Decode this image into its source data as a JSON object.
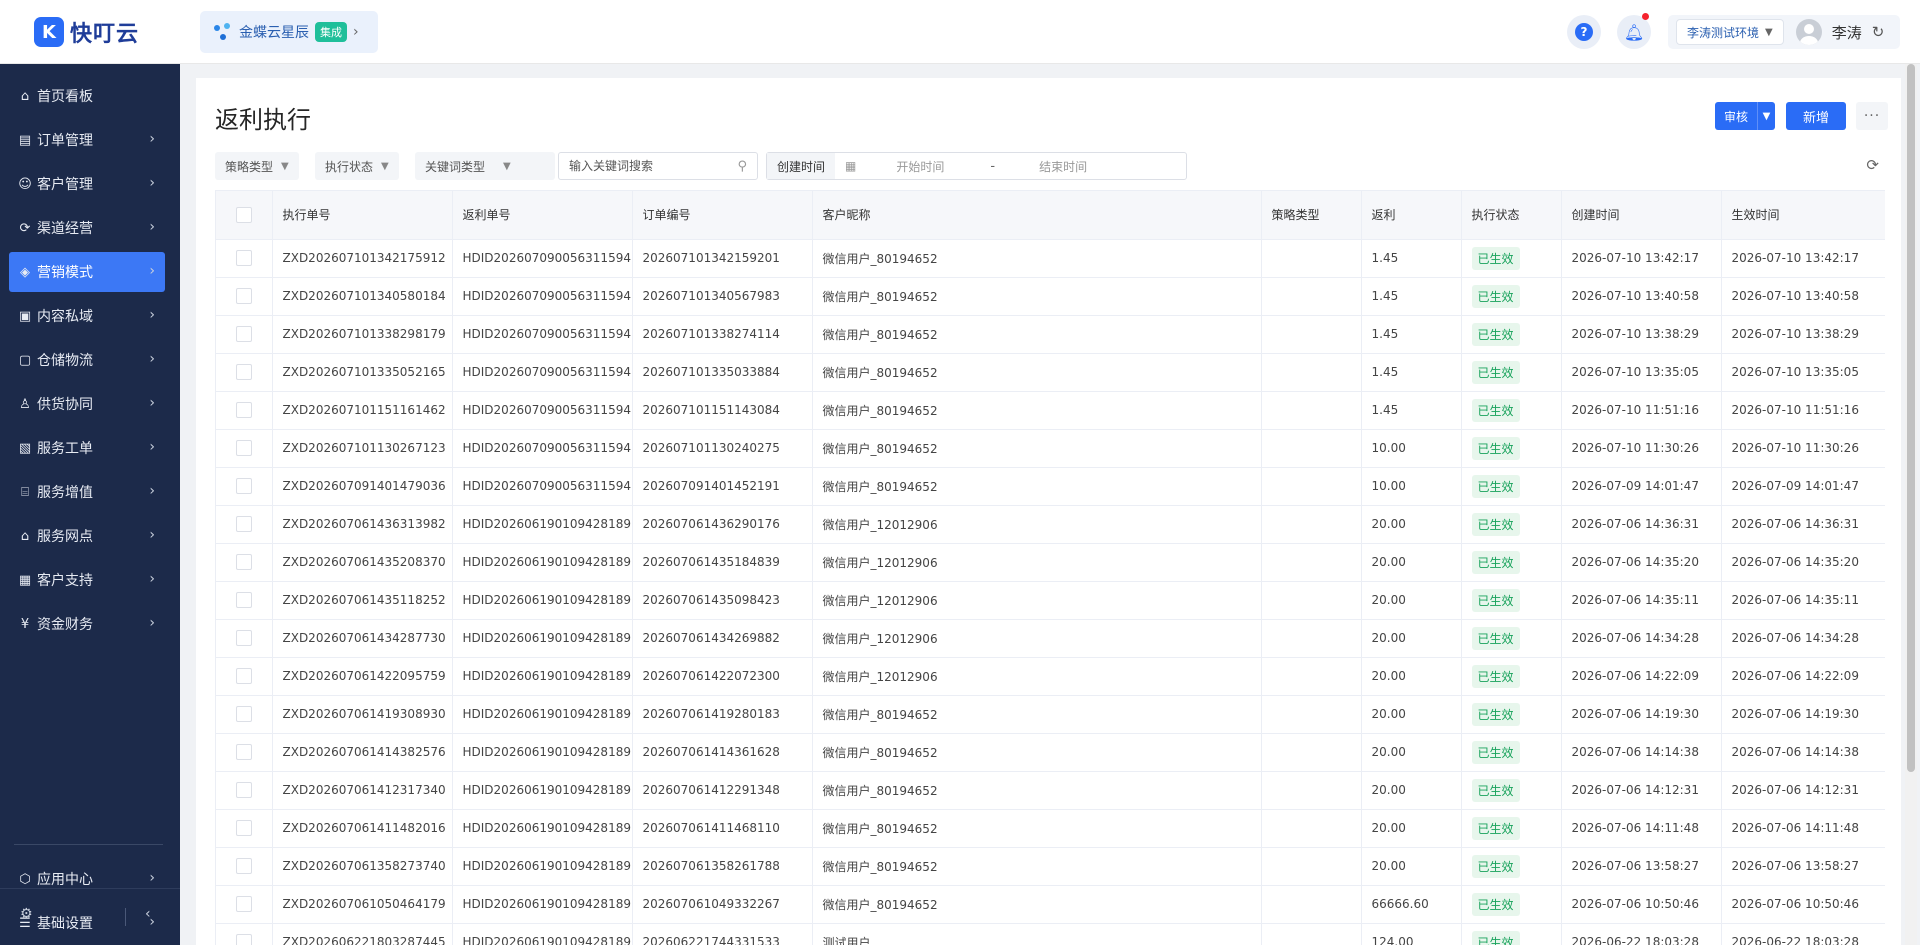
{
  "app": {
    "logo_text": "快叮云",
    "logo_mark": "K",
    "app_switch_label": "金蝶云星辰",
    "app_switch_badge": "集成",
    "environment": "李涛测试环境",
    "user_name": "李涛"
  },
  "sidebar": {
    "items": [
      {
        "label": "首页看板",
        "icon": "home-icon",
        "glyph": "⌂"
      },
      {
        "label": "订单管理",
        "icon": "order-doc-icon",
        "glyph": "▤"
      },
      {
        "label": "客户管理",
        "icon": "user-icon",
        "glyph": "☺"
      },
      {
        "label": "渠道经营",
        "icon": "channel-icon",
        "glyph": "⟳"
      },
      {
        "label": "营销模式",
        "icon": "tag-icon",
        "glyph": "◈"
      },
      {
        "label": "内容私域",
        "icon": "image-icon",
        "glyph": "▣"
      },
      {
        "label": "仓储物流",
        "icon": "warehouse-icon",
        "glyph": "▢"
      },
      {
        "label": "供货协同",
        "icon": "supply-icon",
        "glyph": "♙"
      },
      {
        "label": "服务工单",
        "icon": "ticket-icon",
        "glyph": "▧"
      },
      {
        "label": "服务增值",
        "icon": "bag-icon",
        "glyph": "⌸"
      },
      {
        "label": "服务网点",
        "icon": "store-icon",
        "glyph": "⌂"
      },
      {
        "label": "客户支持",
        "icon": "support-icon",
        "glyph": "▦"
      },
      {
        "label": "资金财务",
        "icon": "yen-icon",
        "glyph": "¥"
      }
    ],
    "active_index": 4,
    "bottom_items": [
      {
        "label": "应用中心",
        "icon": "app-center-icon",
        "glyph": "⬡"
      },
      {
        "label": "基础设置",
        "icon": "settings-list-icon",
        "glyph": "☰"
      }
    ]
  },
  "page": {
    "title": "返利执行",
    "actions": {
      "audit": "审核",
      "new": "新增",
      "more": "···"
    }
  },
  "filters": {
    "strategy_type": "策略类型",
    "exec_status": "执行状态",
    "keyword_type": "关键词类型",
    "search_placeholder": "输入关键词搜索",
    "created_time_label": "创建时间",
    "start_placeholder": "开始时间",
    "range_sep": "-",
    "end_placeholder": "结束时间"
  },
  "table": {
    "columns": [
      "执行单号",
      "返利单号",
      "订单编号",
      "客户昵称",
      "策略类型",
      "返利",
      "执行状态",
      "创建时间",
      "生效时间"
    ],
    "rows": [
      [
        "ZXD202607101342175912",
        "HDID202607090056311594",
        "202607101342159201",
        "微信用户_80194652",
        "",
        "1.45",
        "已生效",
        "2026-07-10 13:42:17",
        "2026-07-10 13:42:17"
      ],
      [
        "ZXD202607101340580184",
        "HDID202607090056311594",
        "202607101340567983",
        "微信用户_80194652",
        "",
        "1.45",
        "已生效",
        "2026-07-10 13:40:58",
        "2026-07-10 13:40:58"
      ],
      [
        "ZXD202607101338298179",
        "HDID202607090056311594",
        "202607101338274114",
        "微信用户_80194652",
        "",
        "1.45",
        "已生效",
        "2026-07-10 13:38:29",
        "2026-07-10 13:38:29"
      ],
      [
        "ZXD202607101335052165",
        "HDID202607090056311594",
        "202607101335033884",
        "微信用户_80194652",
        "",
        "1.45",
        "已生效",
        "2026-07-10 13:35:05",
        "2026-07-10 13:35:05"
      ],
      [
        "ZXD202607101151161462",
        "HDID202607090056311594",
        "202607101151143084",
        "微信用户_80194652",
        "",
        "1.45",
        "已生效",
        "2026-07-10 11:51:16",
        "2026-07-10 11:51:16"
      ],
      [
        "ZXD202607101130267123",
        "HDID202607090056311594",
        "202607101130240275",
        "微信用户_80194652",
        "",
        "10.00",
        "已生效",
        "2026-07-10 11:30:26",
        "2026-07-10 11:30:26"
      ],
      [
        "ZXD202607091401479036",
        "HDID202607090056311594",
        "202607091401452191",
        "微信用户_80194652",
        "",
        "10.00",
        "已生效",
        "2026-07-09 14:01:47",
        "2026-07-09 14:01:47"
      ],
      [
        "ZXD202607061436313982",
        "HDID202606190109428189",
        "202607061436290176",
        "微信用户_12012906",
        "",
        "20.00",
        "已生效",
        "2026-07-06 14:36:31",
        "2026-07-06 14:36:31"
      ],
      [
        "ZXD202607061435208370",
        "HDID202606190109428189",
        "202607061435184839",
        "微信用户_12012906",
        "",
        "20.00",
        "已生效",
        "2026-07-06 14:35:20",
        "2026-07-06 14:35:20"
      ],
      [
        "ZXD202607061435118252",
        "HDID202606190109428189",
        "202607061435098423",
        "微信用户_12012906",
        "",
        "20.00",
        "已生效",
        "2026-07-06 14:35:11",
        "2026-07-06 14:35:11"
      ],
      [
        "ZXD202607061434287730",
        "HDID202606190109428189",
        "202607061434269882",
        "微信用户_12012906",
        "",
        "20.00",
        "已生效",
        "2026-07-06 14:34:28",
        "2026-07-06 14:34:28"
      ],
      [
        "ZXD202607061422095759",
        "HDID202606190109428189",
        "202607061422072300",
        "微信用户_12012906",
        "",
        "20.00",
        "已生效",
        "2026-07-06 14:22:09",
        "2026-07-06 14:22:09"
      ],
      [
        "ZXD202607061419308930",
        "HDID202606190109428189",
        "202607061419280183",
        "微信用户_80194652",
        "",
        "20.00",
        "已生效",
        "2026-07-06 14:19:30",
        "2026-07-06 14:19:30"
      ],
      [
        "ZXD202607061414382576",
        "HDID202606190109428189",
        "202607061414361628",
        "微信用户_80194652",
        "",
        "20.00",
        "已生效",
        "2026-07-06 14:14:38",
        "2026-07-06 14:14:38"
      ],
      [
        "ZXD202607061412317340",
        "HDID202606190109428189",
        "202607061412291348",
        "微信用户_80194652",
        "",
        "20.00",
        "已生效",
        "2026-07-06 14:12:31",
        "2026-07-06 14:12:31"
      ],
      [
        "ZXD202607061411482016",
        "HDID202606190109428189",
        "202607061411468110",
        "微信用户_80194652",
        "",
        "20.00",
        "已生效",
        "2026-07-06 14:11:48",
        "2026-07-06 14:11:48"
      ],
      [
        "ZXD202607061358273740",
        "HDID202606190109428189",
        "202607061358261788",
        "微信用户_80194652",
        "",
        "20.00",
        "已生效",
        "2026-07-06 13:58:27",
        "2026-07-06 13:58:27"
      ],
      [
        "ZXD202607061050464179",
        "HDID202606190109428189",
        "202607061049332267",
        "微信用户_80194652",
        "",
        "66666.60",
        "已生效",
        "2026-07-06 10:50:46",
        "2026-07-06 10:50:46"
      ],
      [
        "ZXD202606221803287445",
        "HDID202606190109428189",
        "202606221744331533",
        "测试用户",
        "",
        "124.00",
        "已生效",
        "2026-06-22 18:03:28",
        "2026-06-22 18:03:28"
      ]
    ]
  },
  "colors": {
    "primary": "#2a6cf6",
    "sidebar_bg": "#1c2a4a",
    "status_text": "#19a35c",
    "status_bg": "#e7f6ec"
  }
}
